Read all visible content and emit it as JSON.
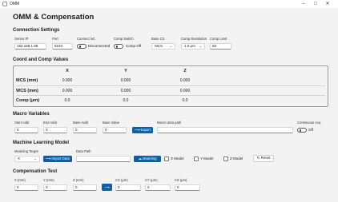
{
  "window": {
    "title": "OMM",
    "minimize": "–",
    "maximize": "□",
    "close": "✕"
  },
  "page_title": "OMM & Compensation",
  "connection": {
    "heading": "Connection Settings",
    "server_ip": {
      "label": "Server IP",
      "value": "192.168.1.88"
    },
    "port": {
      "label": "Port",
      "value": "8193"
    },
    "connect_nc": {
      "label": "Connect NC",
      "state": "Disconnected"
    },
    "comp_switch": {
      "label": "Comp Switch",
      "state": "Comp Off"
    },
    "base_cs": {
      "label": "Base CS",
      "value": "MCS"
    },
    "comp_resolution": {
      "label": "Comp Resolution",
      "value": "1.0 μm"
    },
    "comp_limit": {
      "label": "Comp Limit",
      "value": "50"
    }
  },
  "coords": {
    "heading": "Coord and Comp Values",
    "columns": [
      "X",
      "Y",
      "Z"
    ],
    "rows": [
      {
        "label": "MCS (mm)",
        "values": [
          "0.000",
          "0.000",
          "0.000"
        ]
      },
      {
        "label": "WCS (mm)",
        "values": [
          "0.000",
          "0.000",
          "0.000"
        ]
      },
      {
        "label": "Comp (μm)",
        "values": [
          "0.0",
          "0.0",
          "0.0"
        ]
      }
    ]
  },
  "macro": {
    "heading": "Macro Variables",
    "start_addr": {
      "label": "Start Addr",
      "value": "0"
    },
    "end_addr": {
      "label": "End Addr",
      "value": "0"
    },
    "base_addr": {
      "label": "Base Addr",
      "value": "0"
    },
    "base_value": {
      "label": "Base Value",
      "value": "0"
    },
    "export_label": "Export",
    "data_path_label": "Macro data path",
    "data_path_value": "",
    "continuous_acq": {
      "label": "Continuous Acq",
      "state": "Off"
    }
  },
  "ml": {
    "heading": "Machine Learning Model",
    "modeling_target": {
      "label": "Modeling Target",
      "value": "X"
    },
    "import_label": "Import Data",
    "data_path_label": "Data Path",
    "data_path_value": "",
    "modeling_label": "Modeling",
    "x_model": "X Model",
    "y_model": "Y Model",
    "z_model": "Z Model",
    "reset_label": "Reset"
  },
  "comp_test": {
    "heading": "Compensation Test",
    "x": {
      "label": "X (mm)",
      "value": "0"
    },
    "y": {
      "label": "Y (mm)",
      "value": "0"
    },
    "z": {
      "label": "Z (mm)",
      "value": "0"
    },
    "cx": {
      "label": "CX (μm)",
      "value": "0"
    },
    "cy": {
      "label": "CY (μm)",
      "value": "0"
    },
    "cz": {
      "label": "CZ (μm)",
      "value": "0"
    }
  },
  "colors": {
    "accent": "#0f5ea8",
    "background": "#f3f3f3"
  }
}
